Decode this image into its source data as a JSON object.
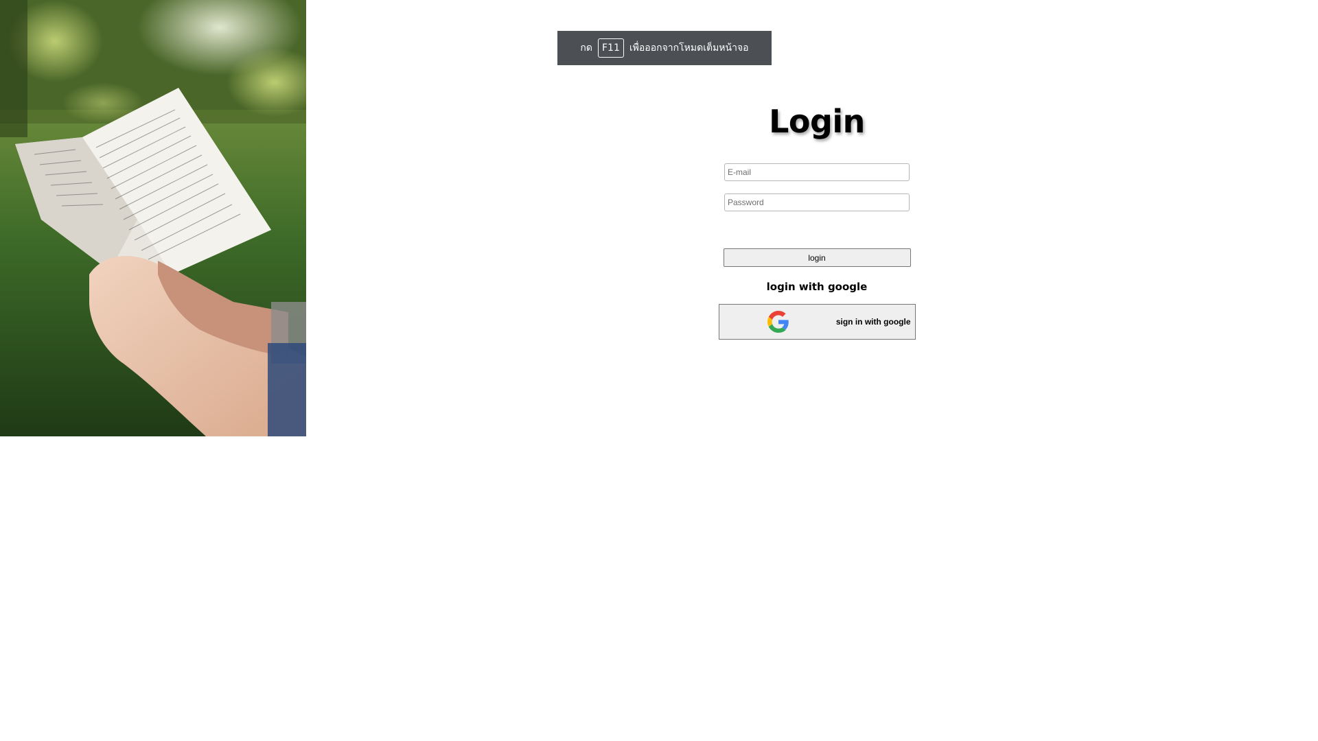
{
  "fullscreen_hint": {
    "prefix": "กด",
    "key": "F11",
    "suffix": "เพื่อออกจากโหมดเต็มหน้าจอ"
  },
  "login": {
    "title": "Login",
    "email_placeholder": "E-mail",
    "password_placeholder": "Password",
    "submit_label": "login",
    "google_caption": "login with google",
    "google_button_label": "sign in with google"
  },
  "hero": {
    "image_icon": "reading-book-photo"
  },
  "colors": {
    "banner_bg": "#4c5055",
    "button_bg": "#efefef",
    "google_blue": "#4285F4",
    "google_red": "#EA4335",
    "google_yellow": "#FBBC05",
    "google_green": "#34A853"
  }
}
